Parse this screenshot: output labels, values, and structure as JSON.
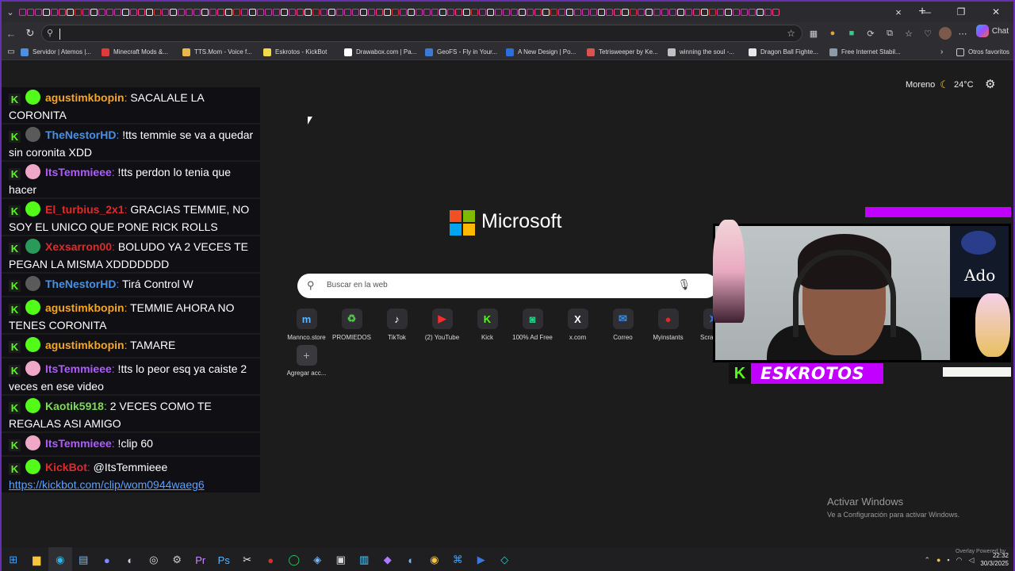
{
  "toolbar": {
    "search_placeholder": "",
    "chat_label": "Chat"
  },
  "bookmarks": [
    {
      "label": "Servidor | Atemos |...",
      "color": "#4a90e2"
    },
    {
      "label": "Minecraft Mods &...",
      "color": "#e03a3a"
    },
    {
      "label": "TTS.Mom - Voice f...",
      "color": "#e8b84a"
    },
    {
      "label": "Eskrotos - KickBot",
      "color": "#f2d94a"
    },
    {
      "label": "Drawabox.com | Pa...",
      "color": "#ffffff"
    },
    {
      "label": "GeoFS - Fly in Your...",
      "color": "#3a7bd5"
    },
    {
      "label": "A New Design | Po...",
      "color": "#2a6fe0"
    },
    {
      "label": "Tetrisweeper by Ke...",
      "color": "#d9534f"
    },
    {
      "label": "winning the soul -...",
      "color": "#c0c0c0"
    },
    {
      "label": "Dragon Ball Fighte...",
      "color": "#e8e8e8"
    },
    {
      "label": "Free Internet Stabil...",
      "color": "#8a9aa8"
    }
  ],
  "other_bookmarks": "Otros favoritos",
  "chat_messages": [
    {
      "user": "agustimkbopin",
      "sep": ":",
      "text": " SACALALE LA CORONITA",
      "user_color": "#f5a623",
      "avatar_color": "#53fc18"
    },
    {
      "user": "TheNestorHD",
      "sep": ":",
      "text": " !tts temmie se va a quedar sin coronita XDD",
      "user_color": "#4a90e2",
      "avatar_color": "#5a5a5a"
    },
    {
      "user": "ItsTemmieee",
      "sep": ":",
      "text": " !tts perdon lo tenia que hacer",
      "user_color": "#b05aff",
      "avatar_color": "#f0a8c8"
    },
    {
      "user": "El_turbius_2x1",
      "sep": ":",
      "text": " GRACIAS TEMMIE, NO SOY EL UNICO QUE PONE RICK ROLLS",
      "user_color": "#e02a2a",
      "avatar_color": "#53fc18"
    },
    {
      "user": "Xexsarron00",
      "sep": ":",
      "text": " BOLUDO YA 2 VECES TE PEGAN LA MISMA XDDDDDDD",
      "user_color": "#e02a2a",
      "avatar_color": "#2a9a5a"
    },
    {
      "user": "TheNestorHD",
      "sep": ":",
      "text": " Tirá Control W",
      "user_color": "#4a90e2",
      "avatar_color": "#5a5a5a"
    },
    {
      "user": "agustimkbopin",
      "sep": ":",
      "text": " TEMMIE AHORA NO TENES CORONITA",
      "user_color": "#f5a623",
      "avatar_color": "#53fc18"
    },
    {
      "user": "agustimkbopin",
      "sep": ":",
      "text": " TAMARE",
      "user_color": "#f5a623",
      "avatar_color": "#53fc18"
    },
    {
      "user": "ItsTemmieee",
      "sep": ":",
      "text": " !tts lo peor esq ya caiste 2 veces en ese video",
      "user_color": "#b05aff",
      "avatar_color": "#f0a8c8"
    },
    {
      "user": "Kaotik5918",
      "sep": ":",
      "text": " 2 VECES COMO TE REGALAS ASI AMIGO",
      "user_color": "#7ed957",
      "avatar_color": "#53fc18"
    },
    {
      "user": "ItsTemmieee",
      "sep": ":",
      "text": " !clip 60",
      "user_color": "#b05aff",
      "avatar_color": "#f0a8c8"
    },
    {
      "user": "KickBot",
      "sep": ":",
      "text": " @ItsTemmieee",
      "user_color": "#e02a2a",
      "avatar_color": "#53fc18",
      "link": "https://kickbot.com/clip/wom0944waeg6"
    }
  ],
  "weather": {
    "location": "Moreno",
    "temp": "24°C"
  },
  "brand": {
    "name": "Microsoft"
  },
  "search": {
    "placeholder": "Buscar en la web"
  },
  "shortcuts": [
    {
      "label": "Mannco.store",
      "glyph": "m",
      "color": "#5ab4ff"
    },
    {
      "label": "PROMIEDOS",
      "glyph": "♻",
      "color": "#53c14b"
    },
    {
      "label": "TikTok",
      "glyph": "♪",
      "color": "#ffffff"
    },
    {
      "label": "(2) YouTube",
      "glyph": "▶",
      "color": "#ff2a2a"
    },
    {
      "label": "Kick",
      "glyph": "K",
      "color": "#53fc18"
    },
    {
      "label": "100% Ad Free",
      "glyph": "◙",
      "color": "#2ad18a"
    },
    {
      "label": "x.com",
      "glyph": "X",
      "color": "#ffffff"
    },
    {
      "label": "Correo",
      "glyph": "✉",
      "color": "#3a8ae0"
    },
    {
      "label": "Myinstants",
      "glyph": "●",
      "color": "#e02a2a"
    },
    {
      "label": "Scrap.TF",
      "glyph": "➤",
      "color": "#3a7ae0"
    }
  ],
  "add_shortcut": "Agregar acc...",
  "streamer": {
    "name": "ESKROTOS",
    "poster_text": "Ado"
  },
  "activate_windows": {
    "title": "Activar Windows",
    "subtitle": "Ve a Configuración para activar Windows."
  },
  "taskbar_overlay": "Overlay Powered by",
  "clock": {
    "time": "22:32",
    "date": "30/3/2025"
  }
}
